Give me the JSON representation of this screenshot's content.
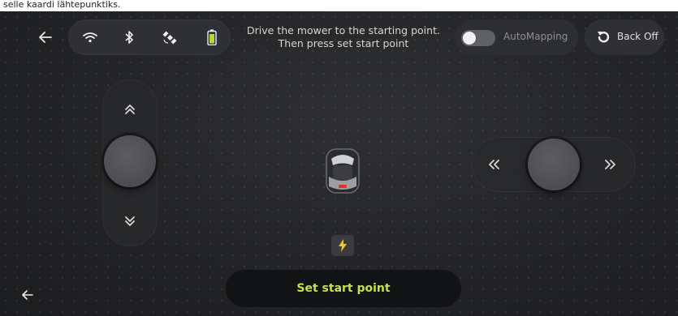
{
  "caption": "selle kaardi lähtepunktiks.",
  "topbar": {
    "back_icon": "arrow-left-icon",
    "status_icons": [
      "wifi-icon",
      "bluetooth-icon",
      "satellite-icon",
      "battery-icon"
    ],
    "instruction_line1": "Drive the mower to the starting point.",
    "instruction_line2": "Then press set start point",
    "automapping_label": "AutoMapping",
    "automapping_on": false,
    "backoff_label": "Back Off"
  },
  "controls": {
    "vertical_up_icon": "double-chevron-up-icon",
    "vertical_down_icon": "double-chevron-down-icon",
    "horizontal_left_icon": "double-chevron-left-icon",
    "horizontal_right_icon": "double-chevron-right-icon"
  },
  "charging_icon": "lightning-icon",
  "set_start_label": "Set start point",
  "bottom_back_icon": "arrow-left-icon",
  "colors": {
    "accent": "#c7e14d",
    "battery": "#b6d83a",
    "charge_bolt": "#f2c230"
  }
}
